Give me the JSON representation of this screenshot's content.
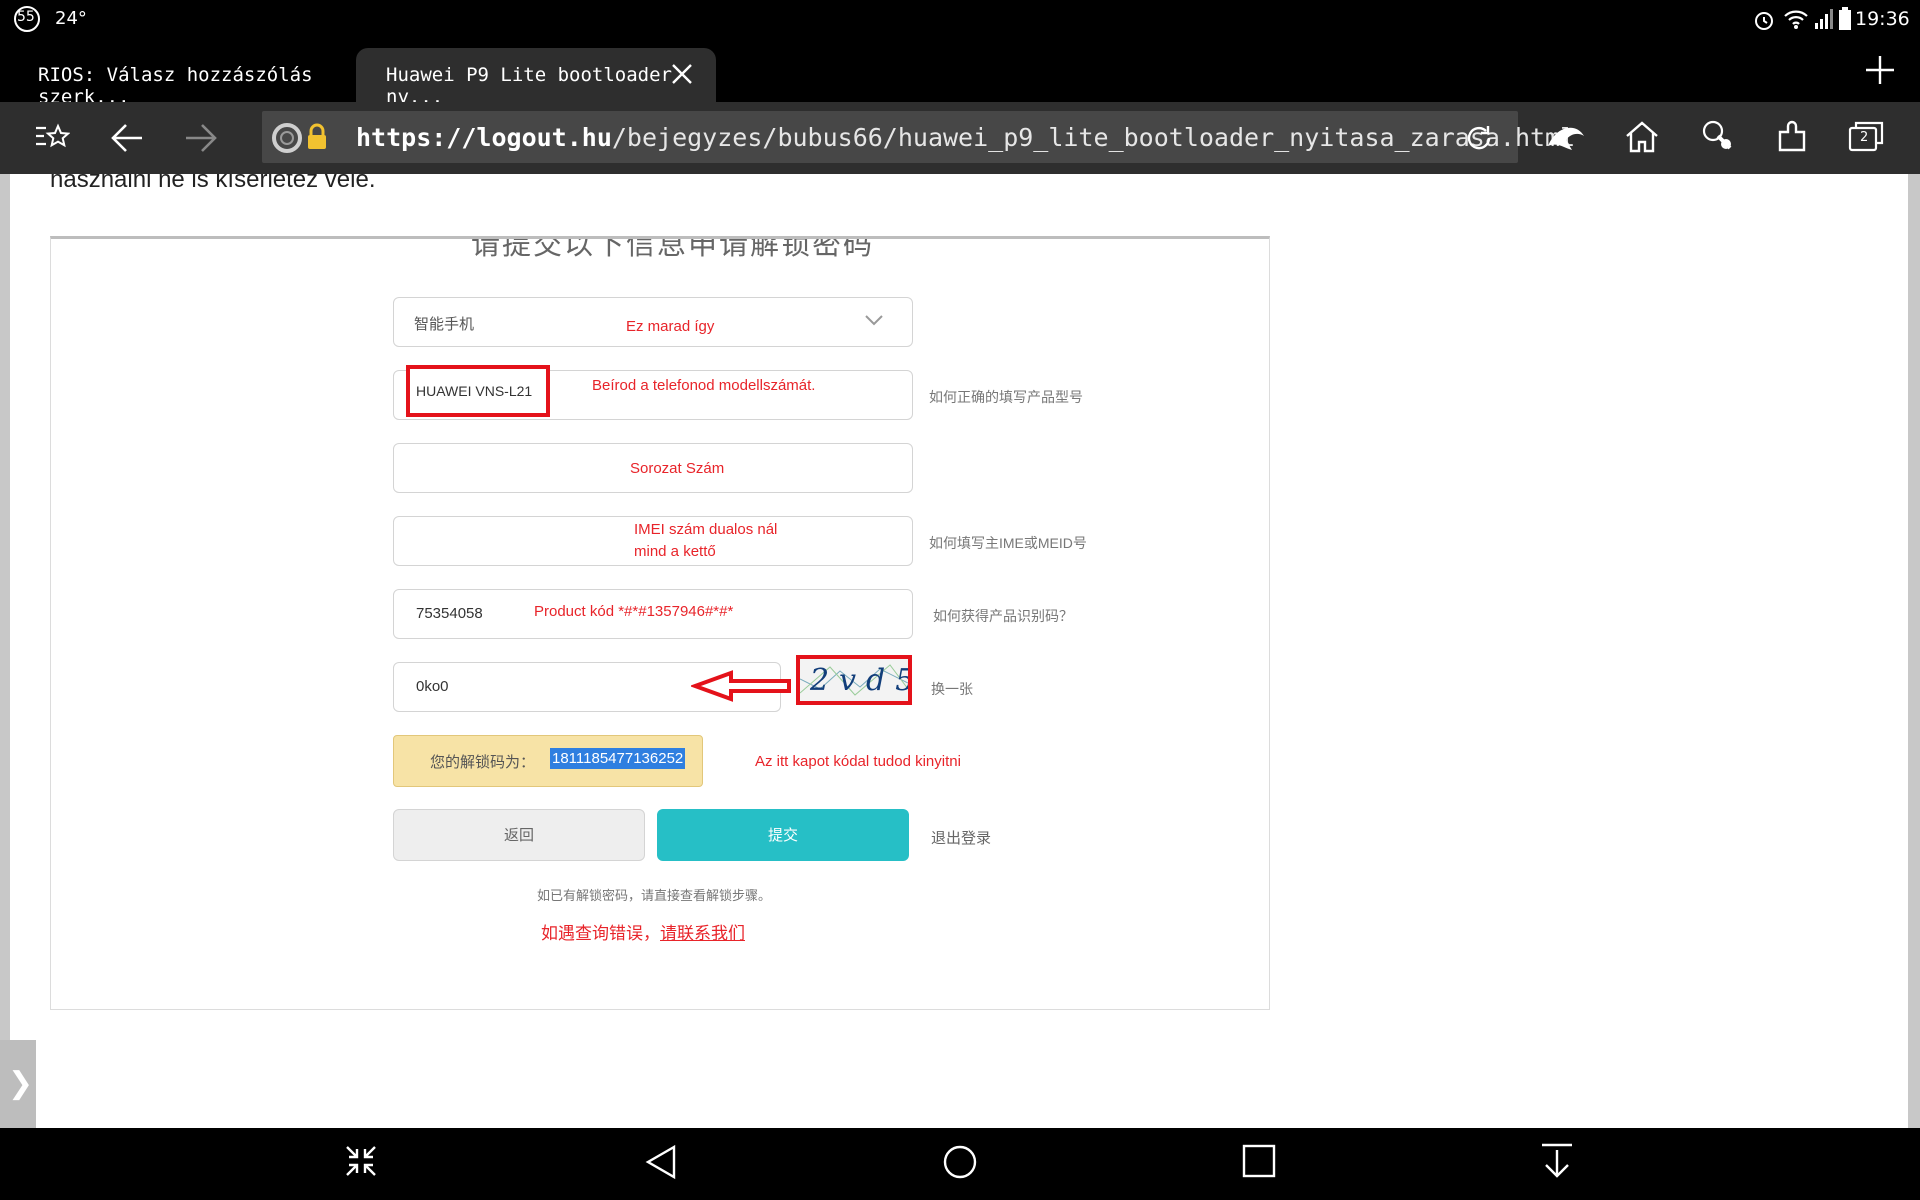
{
  "status_bar": {
    "notif_count": "55",
    "temperature": "24°",
    "time": "19:36"
  },
  "tabs": [
    {
      "label": "RIOS: Válasz hozzászólás szerk...",
      "active": false
    },
    {
      "label": "Huawei P9 Lite bootloader ny...",
      "active": true
    }
  ],
  "toolbar": {
    "url_scheme_host": "https://logout.hu",
    "url_path": "/bejegyzes/bubus66/huawei_p9_lite_bootloader_nyitasa_zarasa.html",
    "tab_count": "2"
  },
  "page": {
    "intro_text": "használni ne is kísérletez vele.",
    "form_title": "请提交以下信息申请解锁密码",
    "device_type_value": "智能手机",
    "device_type_note": "Ez marad így",
    "model_value": "HUAWEI VNS-L21",
    "model_note": "Beírod a telefonod modellszámát.",
    "model_hint": "如何正确的填写产品型号",
    "serial_note": "Sorozat Szám",
    "imei_note_line1": "IMEI szám dualos nál",
    "imei_note_line2": "mind a kettő",
    "imei_hint": "如何填写主IME或MEID号",
    "product_value": "75354058",
    "product_note": "Product kód *#*#1357946#*#*",
    "product_hint": "如何获得产品识别码？",
    "captcha_value": "0ko0",
    "captcha_image_text": "2vd5",
    "captcha_refresh": "换一张",
    "unlock_label": "您的解锁码为：",
    "unlock_code": "1811185477136252",
    "unlock_note": "Az itt kapot kódal tudod kinyitni",
    "back_button": "返回",
    "submit_button": "提交",
    "logout_link": "退出登录",
    "have_code_text": "如已有解锁密码，请直接查看解锁步骤。",
    "error_text": "如遇查询错误，",
    "contact_link": "请联系我们"
  },
  "colors": {
    "submit": "#26bfc6",
    "unlock_bg": "#f7e3a6",
    "annotation_red": "#e4121a",
    "selection": "#2f7fe0"
  }
}
